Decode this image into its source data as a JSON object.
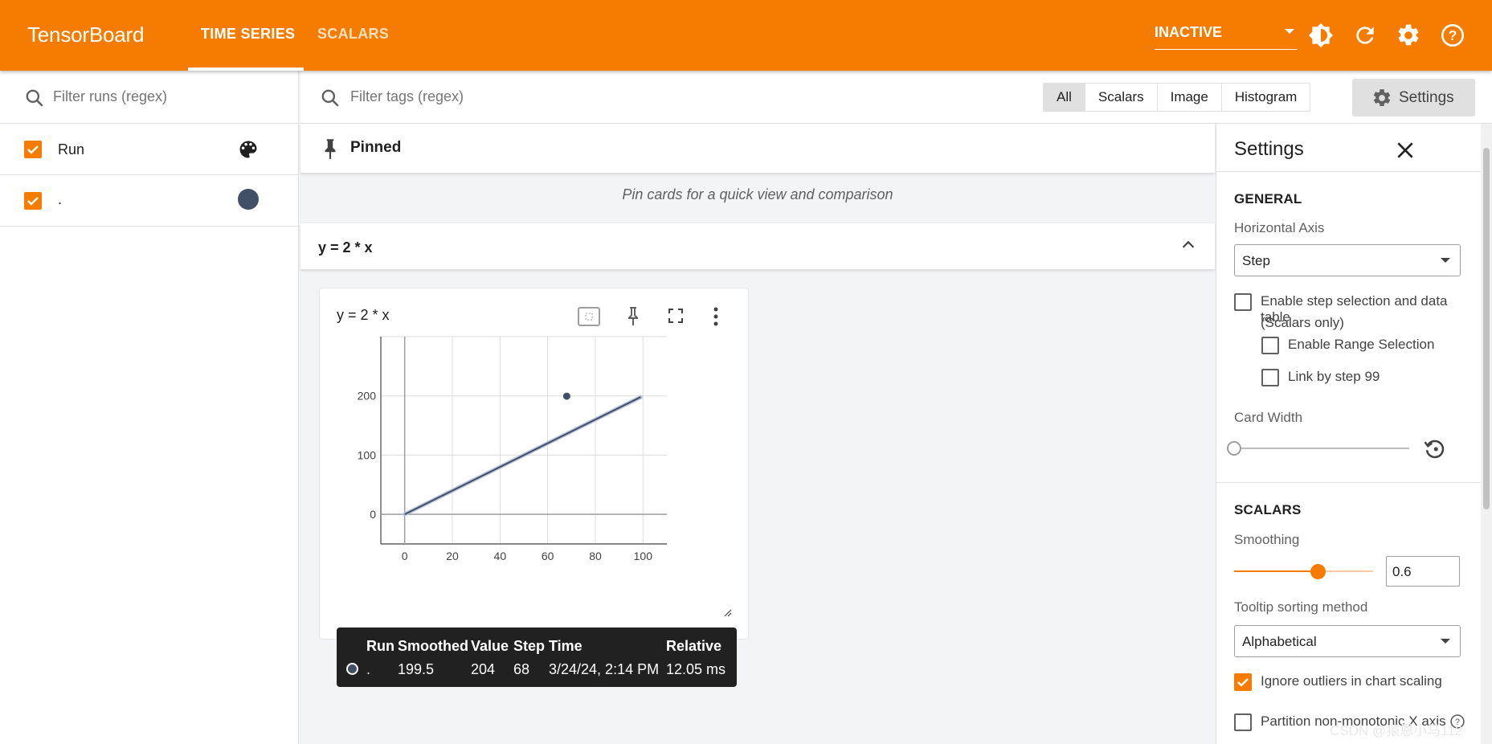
{
  "header": {
    "brand": "TensorBoard",
    "tabs": [
      {
        "label": "TIME SERIES",
        "active": true
      },
      {
        "label": "SCALARS",
        "active": false
      }
    ],
    "run_status": "INACTIVE",
    "accent_color": "#f57c00"
  },
  "runs_panel": {
    "filter_placeholder": "Filter runs (regex)",
    "runs": [
      {
        "label": "Run",
        "checked": true,
        "icon": "palette-icon"
      },
      {
        "label": ".",
        "checked": true,
        "color": "#425066"
      }
    ]
  },
  "main": {
    "filter_placeholder": "Filter tags (regex)",
    "type_filters": [
      "All",
      "Scalars",
      "Image",
      "Histogram"
    ],
    "selected_filter": "All",
    "settings_button": "Settings",
    "pinned_title": "Pinned",
    "pinned_empty": "Pin cards for a quick view and comparison",
    "group_title": "y = 2 * x",
    "card_title": "y = 2 * x"
  },
  "chart_data": {
    "type": "line",
    "title": "y = 2 * x",
    "xlabel": "",
    "ylabel": "",
    "x_ticks": [
      0,
      20,
      40,
      60,
      80,
      100
    ],
    "y_ticks": [
      0,
      100,
      200
    ],
    "xlim": [
      -10,
      110
    ],
    "ylim": [
      -50,
      300
    ],
    "grid": true,
    "series": [
      {
        "name": ".",
        "color": "#425066",
        "x": [
          0,
          99
        ],
        "y": [
          0,
          198
        ]
      }
    ],
    "highlight": {
      "x": 68,
      "y": 199.5
    }
  },
  "tooltip": {
    "headers": [
      "Run",
      "Smoothed",
      "Value",
      "Step",
      "Time",
      "Relative"
    ],
    "row": [
      ".",
      "199.5",
      "204",
      "68",
      "3/24/24, 2:14 PM",
      "12.05 ms"
    ]
  },
  "settings": {
    "title": "Settings",
    "general_header": "GENERAL",
    "horizontal_axis_label": "Horizontal Axis",
    "horizontal_axis_value": "Step",
    "enable_step_selection": "Enable step selection and data table",
    "scalars_only": "(Scalars only)",
    "enable_range_selection": "Enable Range Selection",
    "link_by_step": "Link by step 99",
    "card_width_label": "Card Width",
    "card_width_level": 0,
    "scalars_header": "SCALARS",
    "smoothing_label": "Smoothing",
    "smoothing_value": "0.6",
    "smoothing_level": 0.6,
    "tooltip_sort_label": "Tooltip sorting method",
    "tooltip_sort_value": "Alphabetical",
    "ignore_outliers": "Ignore outliers in chart scaling",
    "ignore_outliers_checked": true,
    "partition": "Partition non-monotonic X axis"
  },
  "watermark": "CSDN @猿恩小马112"
}
